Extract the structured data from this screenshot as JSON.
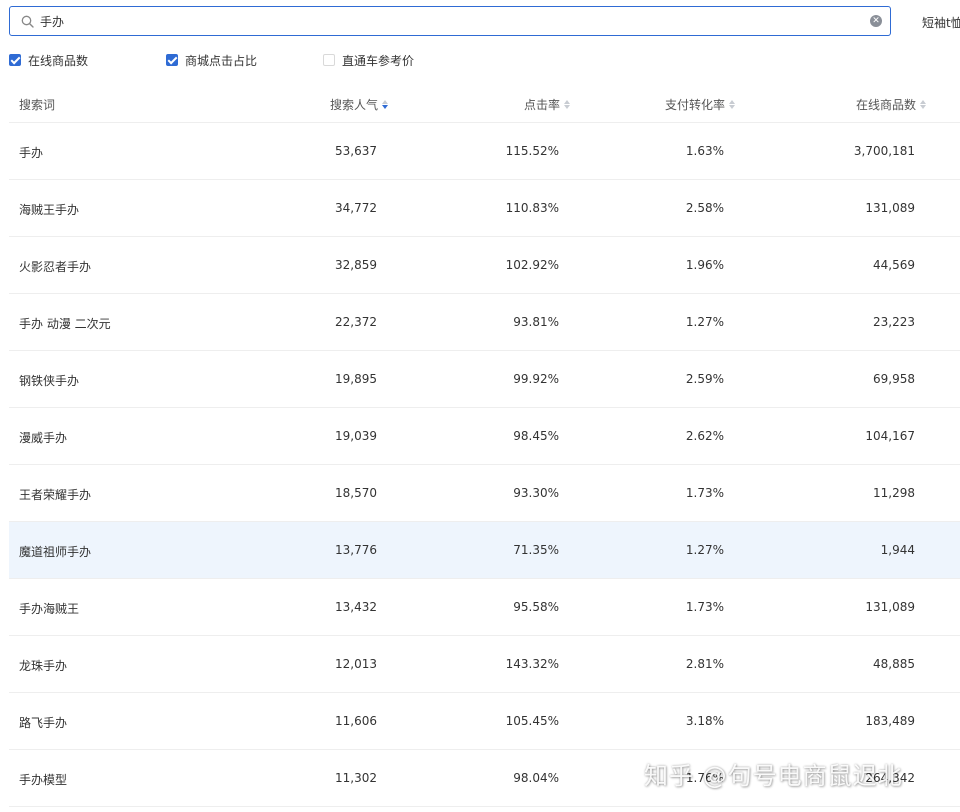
{
  "search": {
    "value": "手办",
    "icon": "search-icon",
    "clear_icon": "close-circle-icon",
    "suggestion": "短袖t恤"
  },
  "filters": [
    {
      "label": "在线商品数",
      "checked": true
    },
    {
      "label": "商城点击占比",
      "checked": true
    },
    {
      "label": "直通车参考价",
      "checked": false
    }
  ],
  "table": {
    "columns": [
      {
        "label": "搜索词",
        "sortable": false
      },
      {
        "label": "搜索人气",
        "sortable": true,
        "sort": "desc"
      },
      {
        "label": "点击率",
        "sortable": true
      },
      {
        "label": "支付转化率",
        "sortable": true
      },
      {
        "label": "在线商品数",
        "sortable": true
      }
    ],
    "rows": [
      [
        "手办",
        "53,637",
        "115.52%",
        "1.63%",
        "3,700,181"
      ],
      [
        "海贼王手办",
        "34,772",
        "110.83%",
        "2.58%",
        "131,089"
      ],
      [
        "火影忍者手办",
        "32,859",
        "102.92%",
        "1.96%",
        "44,569"
      ],
      [
        "手办 动漫 二次元",
        "22,372",
        "93.81%",
        "1.27%",
        "23,223"
      ],
      [
        "钢铁侠手办",
        "19,895",
        "99.92%",
        "2.59%",
        "69,958"
      ],
      [
        "漫威手办",
        "19,039",
        "98.45%",
        "2.62%",
        "104,167"
      ],
      [
        "王者荣耀手办",
        "18,570",
        "93.30%",
        "1.73%",
        "11,298"
      ],
      [
        "魔道祖师手办",
        "13,776",
        "71.35%",
        "1.27%",
        "1,944"
      ],
      [
        "手办海贼王",
        "13,432",
        "95.58%",
        "1.73%",
        "131,089"
      ],
      [
        "龙珠手办",
        "12,013",
        "143.32%",
        "2.81%",
        "48,885"
      ],
      [
        "路飞手办",
        "11,606",
        "105.45%",
        "3.18%",
        "183,489"
      ],
      [
        "手办模型",
        "11,302",
        "98.04%",
        "1.76%",
        "264,342"
      ]
    ],
    "highlighted_row": 7
  },
  "watermark": "知乎 @句号电商鼠迟北",
  "colors": {
    "accent": "#2f6bd4",
    "row_highlight": "#eef5fd",
    "border": "#eeeeee"
  }
}
